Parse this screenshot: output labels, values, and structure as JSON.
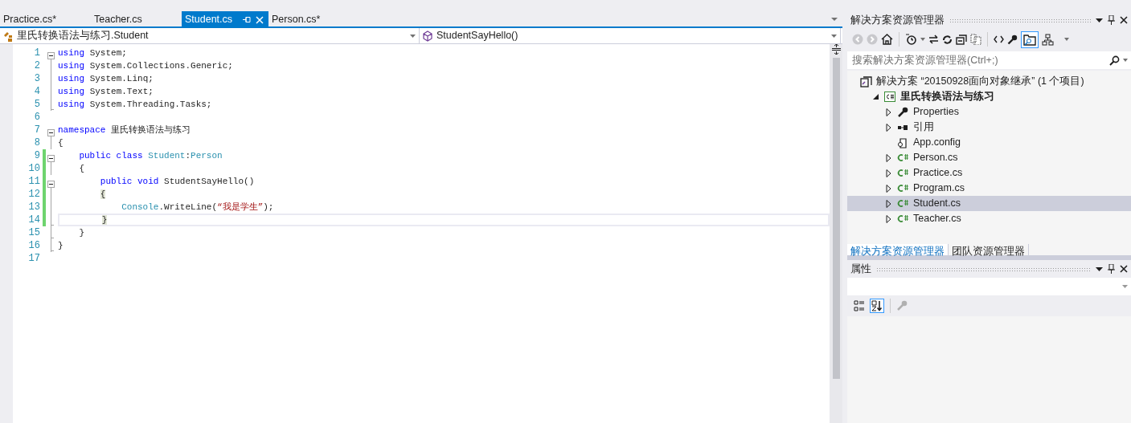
{
  "tabs": [
    {
      "label": "Practice.cs*",
      "selected": false
    },
    {
      "label": "Teacher.cs",
      "selected": false
    },
    {
      "label": "Student.cs",
      "selected": true
    },
    {
      "label": "Person.cs*",
      "selected": false
    }
  ],
  "nav": {
    "type_combo": "里氏转换语法与练习.Student",
    "member_combo": "StudentSayHello()"
  },
  "code_lines": [
    {
      "number": "1",
      "collapsible": true,
      "block_end": false,
      "changed": false,
      "current": false,
      "tokens": [
        {
          "kind": "keyword",
          "text": "using"
        },
        {
          "kind": "plain",
          "text": " System;"
        }
      ]
    },
    {
      "number": "2",
      "collapsible": false,
      "block_end": false,
      "changed": false,
      "current": false,
      "tokens": [
        {
          "kind": "keyword",
          "text": "using"
        },
        {
          "kind": "plain",
          "text": " System.Collections.Generic;"
        }
      ]
    },
    {
      "number": "3",
      "collapsible": false,
      "block_end": false,
      "changed": false,
      "current": false,
      "tokens": [
        {
          "kind": "keyword",
          "text": "using"
        },
        {
          "kind": "plain",
          "text": " System.Linq;"
        }
      ]
    },
    {
      "number": "4",
      "collapsible": false,
      "block_end": false,
      "changed": false,
      "current": false,
      "tokens": [
        {
          "kind": "keyword",
          "text": "using"
        },
        {
          "kind": "plain",
          "text": " System.Text;"
        }
      ]
    },
    {
      "number": "5",
      "collapsible": false,
      "block_end": true,
      "changed": false,
      "current": false,
      "tokens": [
        {
          "kind": "keyword",
          "text": "using"
        },
        {
          "kind": "plain",
          "text": " System.Threading.Tasks;"
        }
      ]
    },
    {
      "number": "6",
      "collapsible": false,
      "block_end": false,
      "changed": false,
      "current": false
    },
    {
      "number": "7",
      "collapsible": true,
      "block_end": false,
      "changed": false,
      "current": false,
      "tokens": [
        {
          "kind": "keyword",
          "text": "namespace"
        },
        {
          "kind": "plain",
          "text": " 里氏转换语法与练习"
        }
      ]
    },
    {
      "number": "8",
      "collapsible": false,
      "block_end": false,
      "changed": false,
      "current": false,
      "tokens": [
        {
          "kind": "plain",
          "text": "{"
        }
      ]
    },
    {
      "number": "9",
      "collapsible": true,
      "block_end": false,
      "changed": true,
      "current": false,
      "tokens": [
        {
          "kind": "keyword",
          "text": "    public class "
        },
        {
          "kind": "type",
          "text": "Student"
        },
        {
          "kind": "plain",
          "text": ":"
        },
        {
          "kind": "type",
          "text": "Person"
        }
      ]
    },
    {
      "number": "10",
      "collapsible": false,
      "block_end": false,
      "changed": true,
      "current": false,
      "tokens": [
        {
          "kind": "plain",
          "text": "    {"
        }
      ]
    },
    {
      "number": "11",
      "collapsible": true,
      "block_end": false,
      "changed": true,
      "current": false,
      "tokens": [
        {
          "kind": "keyword",
          "text": "        public void"
        },
        {
          "kind": "plain",
          "text": " StudentSayHello()"
        }
      ]
    },
    {
      "number": "12",
      "collapsible": false,
      "block_end": false,
      "changed": true,
      "current": false,
      "tokens": [
        {
          "kind": "brace",
          "text": "        {"
        }
      ]
    },
    {
      "number": "13",
      "collapsible": false,
      "block_end": false,
      "changed": true,
      "current": false,
      "tokens": [
        {
          "kind": "type",
          "text": "            Console"
        },
        {
          "kind": "plain",
          "text": ".WriteLine("
        },
        {
          "kind": "string",
          "text": "“我是学生”"
        },
        {
          "kind": "plain",
          "text": ");"
        }
      ]
    },
    {
      "number": "14",
      "collapsible": false,
      "block_end": true,
      "changed": true,
      "current": true,
      "tokens": [
        {
          "kind": "brace",
          "text": "        }"
        }
      ]
    },
    {
      "number": "15",
      "collapsible": false,
      "block_end": true,
      "changed": false,
      "current": false,
      "tokens": [
        {
          "kind": "plain",
          "text": "    }"
        }
      ]
    },
    {
      "number": "16",
      "collapsible": false,
      "block_end": true,
      "changed": false,
      "current": false,
      "tokens": [
        {
          "kind": "plain",
          "text": "}"
        }
      ]
    },
    {
      "number": "17",
      "collapsible": false,
      "block_end": false,
      "changed": false,
      "current": false
    }
  ],
  "solution_explorer": {
    "title": "解决方案资源管理器",
    "search": {
      "placeholder": "搜索解决方案资源管理器(Ctrl+;)"
    },
    "tree": [
      {
        "label": "解决方案 “20150928面向对象继承” (1 个项目)",
        "kind": "solution",
        "selected": false,
        "children": [
          {
            "label": "里氏转换语法与练习",
            "kind": "project",
            "expanded": true,
            "selected": false,
            "children": [
              {
                "label": "Properties",
                "kind": "properties",
                "expanded": false,
                "selected": false
              },
              {
                "label": "引用",
                "kind": "references",
                "expanded": false,
                "selected": false
              },
              {
                "label": "App.config",
                "kind": "config",
                "selected": false
              },
              {
                "label": "Person.cs",
                "kind": "csharp",
                "expanded": false,
                "selected": false
              },
              {
                "label": "Practice.cs",
                "kind": "csharp",
                "expanded": false,
                "selected": false
              },
              {
                "label": "Program.cs",
                "kind": "csharp",
                "expanded": false,
                "selected": false
              },
              {
                "label": "Student.cs",
                "kind": "csharp",
                "expanded": false,
                "selected": true
              },
              {
                "label": "Teacher.cs",
                "kind": "csharp",
                "expanded": false,
                "selected": false
              }
            ]
          }
        ]
      }
    ]
  },
  "bottom_tabs": [
    {
      "label": "解决方案资源管理器",
      "selected": true
    },
    {
      "label": "团队资源管理器",
      "selected": false
    }
  ],
  "properties": {
    "title": "属性",
    "sort_buttons": [
      {
        "kind": "categorized",
        "selected": false
      },
      {
        "kind": "alphabetical",
        "selected": true
      }
    ]
  }
}
